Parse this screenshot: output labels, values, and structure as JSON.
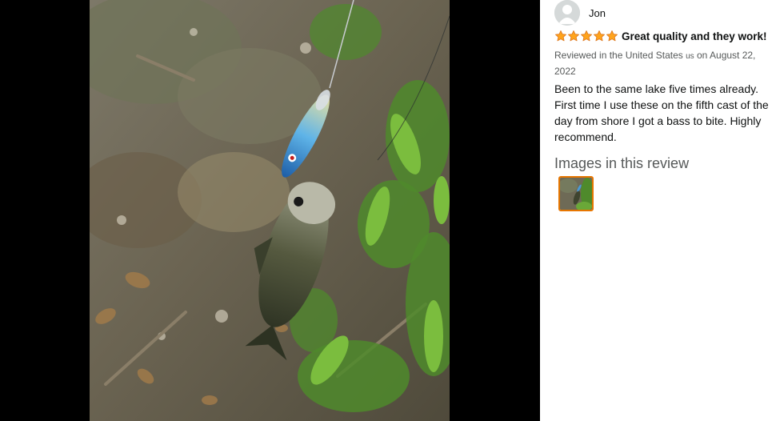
{
  "reviewer": {
    "name": "Jon",
    "avatar_icon": "default-avatar-icon"
  },
  "review": {
    "rating": 5,
    "rating_max": 5,
    "star_icon": "star-icon",
    "title": "Great quality and they work!",
    "meta_prefix": "Reviewed in the United States ",
    "meta_country_code": "us",
    "meta_suffix": " on August 22, 2022",
    "body": "Been to the same lake five times already. First time I use these on the fifth cast of the day from shore I got a bass to bite. Highly recommend."
  },
  "images_section": {
    "heading": "Images in this review",
    "thumbnail_count": 1
  },
  "colors": {
    "viewer_background": "#000000",
    "star_fill": "#ffa41c",
    "star_stroke": "#de7921",
    "thumbnail_border": "#e77600",
    "meta_text": "#565959",
    "body_text": "#0f1111"
  }
}
